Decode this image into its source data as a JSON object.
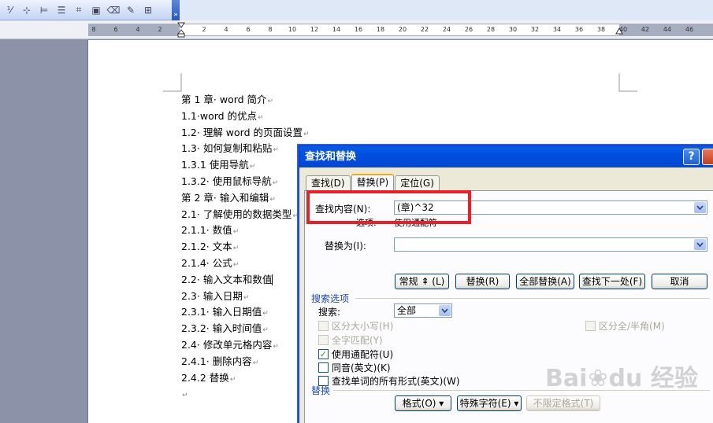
{
  "toolbar": {
    "icons": [
      "numbering-icon",
      "insert-table-icon",
      "merge-cells-icon",
      "align-icon",
      "distribute-icon",
      "table-properties-icon",
      "eraser-icon",
      "pen-icon",
      "toolbar-options-icon"
    ],
    "overflow_glyph": "»"
  },
  "ruler": {
    "ticks": [
      "8",
      "6",
      "4",
      "2",
      "2",
      "4",
      "6",
      "8",
      "10",
      "12",
      "14",
      "16",
      "18",
      "20",
      "22",
      "24",
      "26",
      "28",
      "30",
      "32",
      "34",
      "36",
      "38",
      "40",
      "42",
      "44",
      "46"
    ]
  },
  "document": {
    "lines": [
      "第 1 章· word 简介",
      "1.1·word 的优点",
      "1.2· 理解 word 的页面设置",
      "1.3· 如何复制和粘贴",
      "1.3.1 使用导航",
      "1.3.2· 使用鼠标导航",
      "第 2 章· 输入和编辑",
      "2.1· 了解使用的数据类型",
      "2.1.1· 数值",
      "2.1.2· 文本",
      "2.1.4· 公式",
      "2.2· 输入文本和数值",
      "2.3· 输入日期",
      "2.3.1· 输入日期值",
      "2.3.2· 输入时间值",
      "2.4· 修改单元格内容",
      "2.4.1· 删除内容",
      "2.4.2 替换",
      ""
    ],
    "paragraph_mark": "↵"
  },
  "dialog": {
    "title": "查找和替换",
    "help_label": "?",
    "tabs": [
      {
        "label": "查找(D)",
        "active": false
      },
      {
        "label": "替换(P)",
        "active": true
      },
      {
        "label": "定位(G)",
        "active": false
      }
    ],
    "find": {
      "label": "查找内容(N):",
      "value": "(章)^32"
    },
    "options": {
      "label": "选项:",
      "value": "使用通配符"
    },
    "replace": {
      "label": "替换为(I):",
      "value": ""
    },
    "buttons": {
      "less": "常规 ⇞ (L)",
      "replace": "替换(R)",
      "replace_all": "全部替换(A)",
      "find_next": "查找下一处(F)",
      "cancel": "取消"
    },
    "search_options": {
      "section_label": "搜索选项",
      "search_label": "搜索:",
      "search_value": "全部",
      "match_case": {
        "label": "区分大小写(H)",
        "checked": false,
        "enabled": false
      },
      "whole_word": {
        "label": "全字匹配(Y)",
        "checked": false,
        "enabled": false
      },
      "wildcards": {
        "label": "使用通配符(U)",
        "checked": true,
        "enabled": true
      },
      "sounds_like": {
        "label": "同音(英文)(K)",
        "checked": false,
        "enabled": true
      },
      "word_forms": {
        "label": "查找单词的所有形式(英文)(W)",
        "checked": false,
        "enabled": true
      },
      "full_half": {
        "label": "区分全/半角(M)",
        "checked": false,
        "enabled": false
      }
    },
    "replace_section": {
      "section_label": "替换",
      "format": "格式(O) ▾",
      "special": "特殊字符(E) ▾",
      "no_formatting": "不限定格式(T)"
    }
  },
  "colors": {
    "highlight": "#e8202a",
    "title_bar": "#0a5ce3",
    "dialog_bg": "#ece9d8"
  },
  "watermark": {
    "left": "Bai",
    "right": "经验",
    "paw": "du"
  }
}
